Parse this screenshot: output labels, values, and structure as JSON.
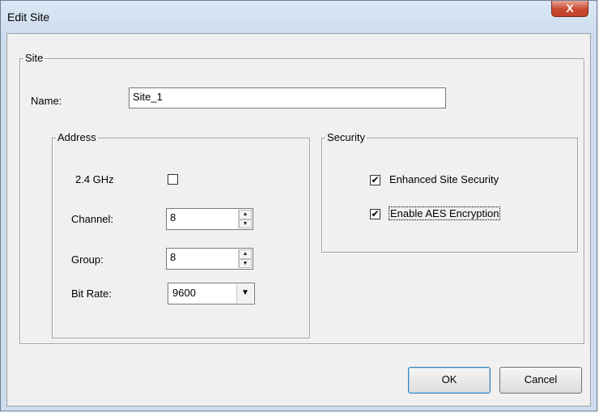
{
  "window": {
    "title": "Edit Site",
    "close_label": "X"
  },
  "site_group": {
    "legend": "Site",
    "name_label": "Name:",
    "name_value": "Site_1"
  },
  "address_group": {
    "legend": "Address",
    "ghz_label": "2.4 GHz",
    "ghz_checked": false,
    "channel_label": "Channel:",
    "channel_value": "8",
    "group_label": "Group:",
    "group_value": "8",
    "bitrate_label": "Bit Rate:",
    "bitrate_value": "9600"
  },
  "security_group": {
    "legend": "Security",
    "enhanced_label": "Enhanced Site Security",
    "enhanced_checked": true,
    "aes_label": "Enable AES Encryption",
    "aes_checked": true
  },
  "buttons": {
    "ok": "OK",
    "cancel": "Cancel"
  },
  "icons": {
    "spin_up": "spin-up-arrow",
    "spin_down": "spin-down-arrow",
    "dropdown": "chevron-down",
    "check": "checkmark"
  }
}
